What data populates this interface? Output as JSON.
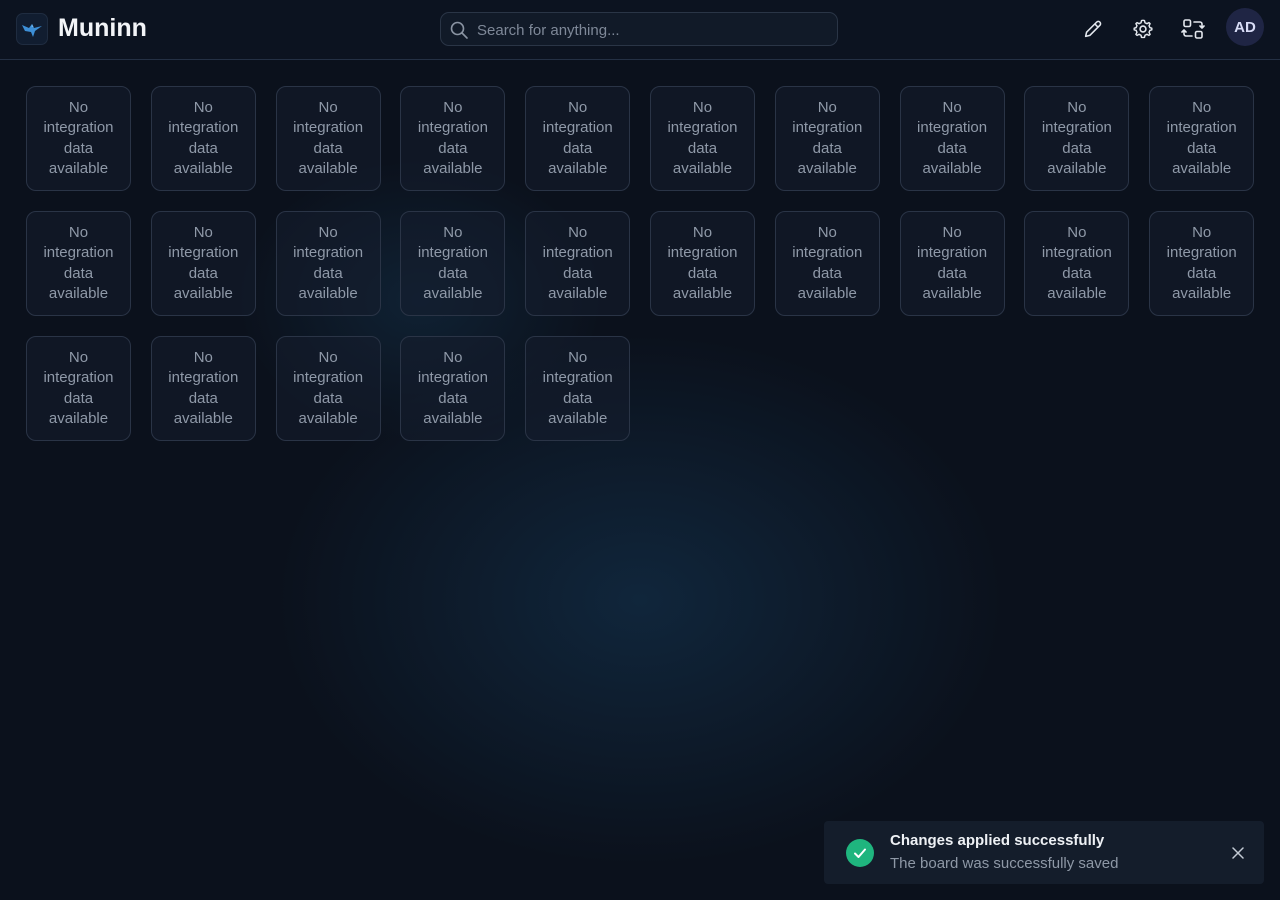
{
  "header": {
    "app_title": "Muninn",
    "logo_icon": "raven-logo-icon",
    "search": {
      "placeholder": "Search for anything...",
      "value": ""
    },
    "actions": [
      {
        "name": "edit-board",
        "icon": "pencil-icon"
      },
      {
        "name": "settings",
        "icon": "gear-icon"
      },
      {
        "name": "switch-board",
        "icon": "swap-layout-icon"
      }
    ],
    "avatar_initials": "AD"
  },
  "board": {
    "items": [
      {
        "text": "No integration data available"
      },
      {
        "text": "No integration data available"
      },
      {
        "text": "No integration data available"
      },
      {
        "text": "No integration data available"
      },
      {
        "text": "No integration data available"
      },
      {
        "text": "No integration data available"
      },
      {
        "text": "No integration data available"
      },
      {
        "text": "No integration data available"
      },
      {
        "text": "No integration data available"
      },
      {
        "text": "No integration data available"
      },
      {
        "text": "No integration data available"
      },
      {
        "text": "No integration data available"
      },
      {
        "text": "No integration data available"
      },
      {
        "text": "No integration data available"
      },
      {
        "text": "No integration data available"
      },
      {
        "text": "No integration data available"
      },
      {
        "text": "No integration data available"
      },
      {
        "text": "No integration data available"
      },
      {
        "text": "No integration data available"
      },
      {
        "text": "No integration data available"
      },
      {
        "text": "No integration data available"
      },
      {
        "text": "No integration data available"
      },
      {
        "text": "No integration data available"
      },
      {
        "text": "No integration data available"
      },
      {
        "text": "No integration data available"
      }
    ]
  },
  "toast": {
    "title": "Changes applied successfully",
    "message": "The board was successfully saved",
    "status_color": "#1fb57e",
    "icon": "check-icon",
    "close_icon": "close-icon"
  },
  "colors": {
    "background": "#0b111c",
    "card_border": "#2a3446",
    "success": "#1fb57e"
  }
}
